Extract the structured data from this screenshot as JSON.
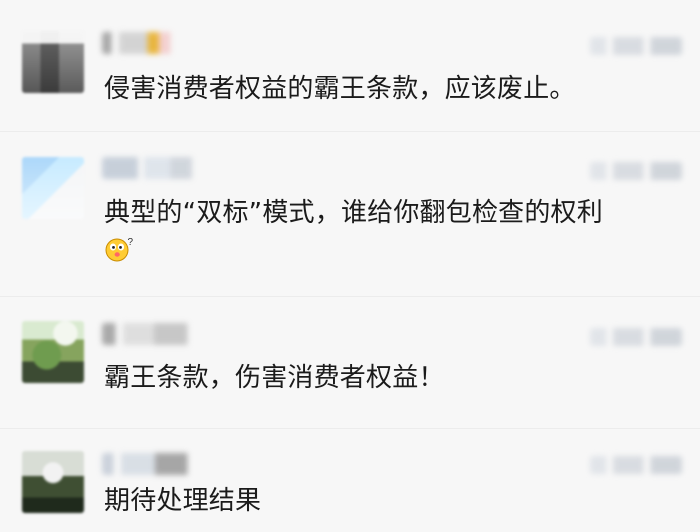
{
  "comments": [
    {
      "text": "侵害消费者权益的霸王条款，应该废止。"
    },
    {
      "text": "典型的“双标”模式，谁给你翻包检查的权利",
      "emoji": "surprised-face-icon"
    },
    {
      "text": "霸王条款，伤害消费者权益！"
    },
    {
      "text": "期待处理结果"
    }
  ]
}
